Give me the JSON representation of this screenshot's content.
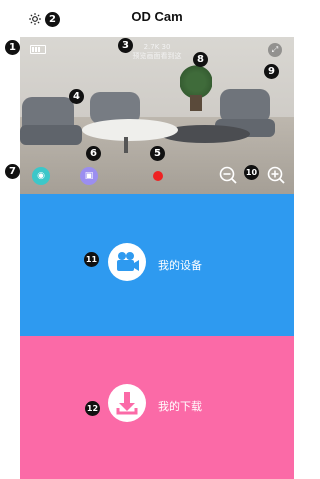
{
  "header": {
    "title": "OD Cam",
    "settings_icon": "gear-icon"
  },
  "preview": {
    "resolution": "2.7K 30",
    "status_text": "预览画面看到这",
    "battery_icon": "battery-icon",
    "fullscreen_icon": "expand-icon"
  },
  "controls": {
    "photo_icon": "camera-icon",
    "video_icon": "video-icon",
    "record_icon": "record-icon",
    "zoom_out_icon": "zoom-out-icon",
    "zoom_in_icon": "zoom-in-icon",
    "photo_color": "#3cc7c9",
    "video_color": "#9b8ef0",
    "record_color": "#ee2222"
  },
  "menu": [
    {
      "label": "我的设备",
      "icon": "video-camera-icon",
      "color": "#2e9af0"
    },
    {
      "label": "我的下载",
      "icon": "download-icon",
      "color": "#fb6aa7"
    }
  ],
  "annotations": [
    "1",
    "2",
    "3",
    "4",
    "5",
    "6",
    "7",
    "8",
    "9",
    "10",
    "11",
    "12"
  ]
}
